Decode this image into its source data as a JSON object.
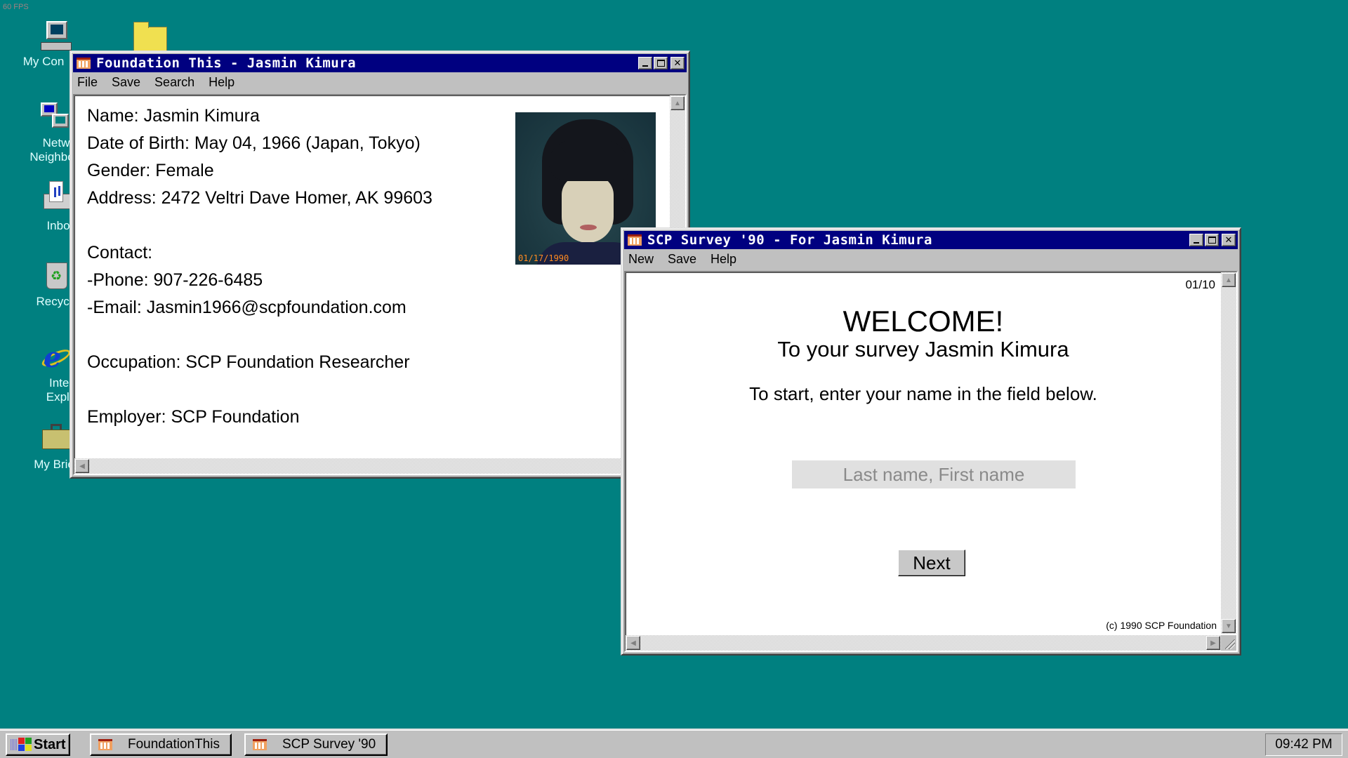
{
  "overlay": {
    "fps": "60 FPS"
  },
  "desktop": {
    "icons": [
      {
        "label": "My Computer",
        "visible_label": "My Con",
        "icon": "computer-icon"
      },
      {
        "label_line1": "Netw",
        "label_line2": "Neighbo",
        "icon": "network-neighborhood-icon"
      },
      {
        "label": "Inbo",
        "icon": "inbox-icon"
      },
      {
        "label": "Recycl",
        "icon": "recycle-bin-icon"
      },
      {
        "label_line1": "Inter",
        "label_line2": "Explo",
        "icon": "internet-explorer-icon"
      },
      {
        "label": "My Brie",
        "icon": "briefcase-icon"
      }
    ],
    "folder_icon": "folder-icon"
  },
  "profile_window": {
    "title": "Foundation This - Jasmin Kimura",
    "menu": [
      "File",
      "Save",
      "Search",
      "Help"
    ],
    "lines": [
      "Name: Jasmin Kimura",
      "Date of Birth: May 04, 1966 (Japan, Tokyo)",
      "Gender: Female",
      "Address: 2472 Veltri Dave Homer, AK 99603",
      "",
      "Contact:",
      "-Phone: 907-226-6485",
      "-Email: Jasmin1966@scpfoundation.com",
      "",
      "Occupation: SCP Foundation Researcher",
      "",
      "Employer: SCP Foundation"
    ],
    "photo": {
      "alt": "Portrait photo",
      "date_stamp": "01/17/1990"
    }
  },
  "survey_window": {
    "title": "SCP Survey '90 - For Jasmin Kimura",
    "menu": [
      "New",
      "Save",
      "Help"
    ],
    "page_counter": "01/10",
    "welcome": "WELCOME!",
    "subtitle": "To your survey Jasmin Kimura",
    "instruction": "To start, enter your name in the field below.",
    "name_input": {
      "value": "",
      "placeholder": "Last name, First name"
    },
    "next_label": "Next",
    "copyright": "(c) 1990 SCP Foundation"
  },
  "taskbar": {
    "start_label": "Start",
    "tasks": [
      "FoundationThis",
      "SCP Survey '90"
    ],
    "clock": "09:42 PM"
  }
}
